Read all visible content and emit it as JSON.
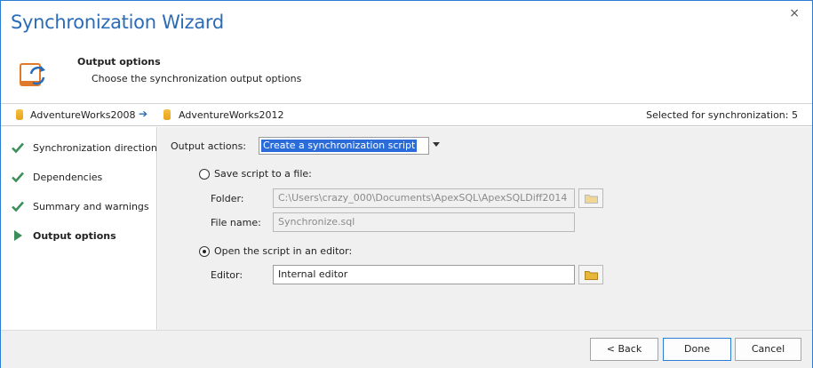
{
  "window": {
    "title": "Synchronization Wizard",
    "close_glyph": "×"
  },
  "header": {
    "heading": "Output options",
    "description": "Choose the synchronization output options"
  },
  "dbbar": {
    "source": "AdventureWorks2008",
    "arrow": "➔",
    "target": "AdventureWorks2012",
    "selected": "Selected for synchronization: 5"
  },
  "steps": [
    {
      "label": "Synchronization direction",
      "state": "done"
    },
    {
      "label": "Dependencies",
      "state": "done"
    },
    {
      "label": "Summary and warnings",
      "state": "done"
    },
    {
      "label": "Output options",
      "state": "current"
    }
  ],
  "output": {
    "actions_label": "Output actions:",
    "actions_value": "Create a synchronization script",
    "save_radio_label": "Save script to a file:",
    "folder_label": "Folder:",
    "folder_value": "C:\\Users\\crazy_000\\Documents\\ApexSQL\\ApexSQLDiff2014",
    "filename_label": "File name:",
    "filename_value": "Synchronize.sql",
    "open_radio_label": "Open the script in an editor:",
    "editor_label": "Editor:",
    "editor_value": "Internal editor",
    "selected_option": "open"
  },
  "footer": {
    "back": "< Back",
    "done": "Done",
    "cancel": "Cancel"
  },
  "colors": {
    "accent": "#2b6cb8",
    "check": "#3d8f5a",
    "selection": "#2b6cd8",
    "folder": "#e8b73a"
  }
}
